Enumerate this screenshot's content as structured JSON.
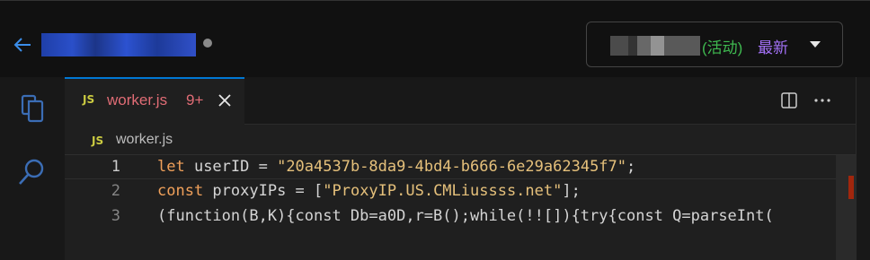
{
  "header": {
    "version_selector": {
      "active_label": "(活动)",
      "latest_label": "最新"
    }
  },
  "tab": {
    "lang_badge": "JS",
    "filename": "worker.js",
    "problems": "9+"
  },
  "breadcrumb": {
    "lang_badge": "JS",
    "filename": "worker.js"
  },
  "code": {
    "lines": [
      {
        "number": "1",
        "keyword": "let",
        "text": " userID = ",
        "string": "\"20a4537b-8da9-4bd4-b666-6e29a62345f7\"",
        "tail": ";"
      },
      {
        "number": "2",
        "keyword": "const",
        "text": " proxyIPs = [",
        "string": "\"ProxyIP.US.CMLiussss.net\"",
        "tail": "];"
      },
      {
        "number": "3",
        "keyword": "",
        "text": "(function(B,K){const Db=a0D,r=B();while(!![]){try{const Q=parseInt(",
        "string": "",
        "tail": ""
      }
    ]
  },
  "colors": {
    "accent": "#0078d4",
    "error": "#e06c75",
    "active_status": "#3fb950",
    "latest_status": "#a371f7"
  }
}
